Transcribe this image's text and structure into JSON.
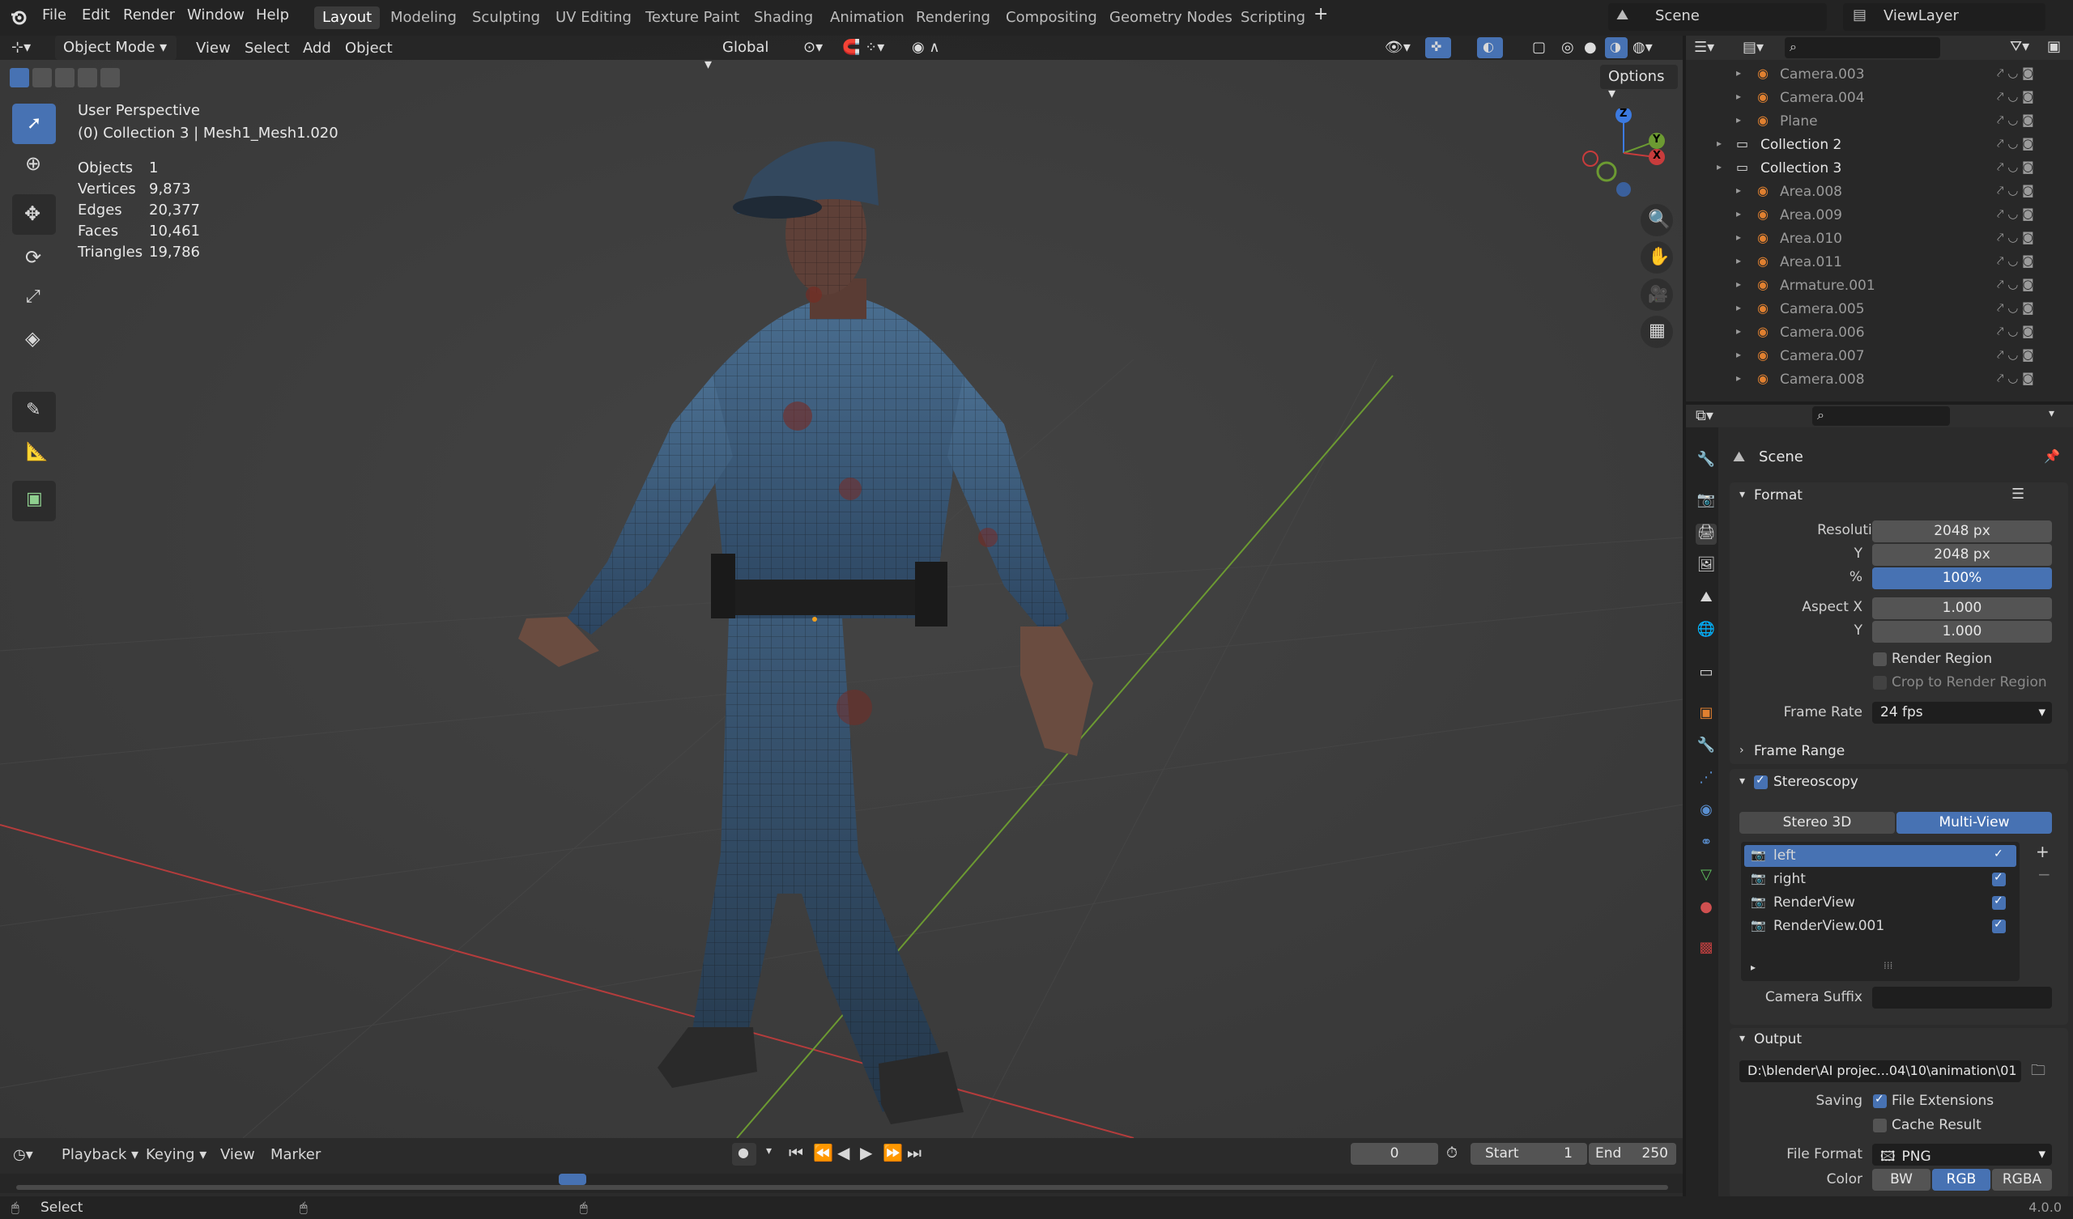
{
  "menu": [
    "File",
    "Edit",
    "Render",
    "Window",
    "Help"
  ],
  "workspaces": [
    "Layout",
    "Modeling",
    "Sculpting",
    "UV Editing",
    "Texture Paint",
    "Shading",
    "Animation",
    "Rendering",
    "Compositing",
    "Geometry Nodes",
    "Scripting"
  ],
  "active_workspace": "Layout",
  "scene_name": "Scene",
  "view_layer": "ViewLayer",
  "viewport_header": {
    "mode": "Object Mode",
    "view": "View",
    "select": "Select",
    "add": "Add",
    "object": "Object",
    "orientation": "Global",
    "options": "Options"
  },
  "overlay": {
    "perspective": "User Perspective",
    "collection_info": "(0) Collection 3 | Mesh1_Mesh1.020",
    "stats": [
      {
        "label": "Objects",
        "value": "1"
      },
      {
        "label": "Vertices",
        "value": "9,873"
      },
      {
        "label": "Edges",
        "value": "20,377"
      },
      {
        "label": "Faces",
        "value": "10,461"
      },
      {
        "label": "Triangles",
        "value": "19,786"
      }
    ]
  },
  "gizmo": {
    "x": "X",
    "y": "Y",
    "z": "Z"
  },
  "outliner": [
    {
      "name": "Camera.003",
      "indent": 2
    },
    {
      "name": "Camera.004",
      "indent": 2
    },
    {
      "name": "Plane",
      "indent": 2
    },
    {
      "name": "Collection 2",
      "indent": 1
    },
    {
      "name": "Collection 3",
      "indent": 1
    },
    {
      "name": "Area.008",
      "indent": 2
    },
    {
      "name": "Area.009",
      "indent": 2
    },
    {
      "name": "Area.010",
      "indent": 2
    },
    {
      "name": "Area.011",
      "indent": 2
    },
    {
      "name": "Armature.001",
      "indent": 2
    },
    {
      "name": "Camera.005",
      "indent": 2
    },
    {
      "name": "Camera.006",
      "indent": 2
    },
    {
      "name": "Camera.007",
      "indent": 2
    },
    {
      "name": "Camera.008",
      "indent": 2
    }
  ],
  "properties": {
    "context": "Scene",
    "format": {
      "title": "Format",
      "resolution_x_label": "Resolution X",
      "resolution_x": "2048 px",
      "y_label": "Y",
      "resolution_y": "2048 px",
      "pct_label": "%",
      "percent": "100%",
      "aspect_x_label": "Aspect X",
      "aspect_x": "1.000",
      "aspect_y_label": "Y",
      "aspect_y": "1.000",
      "render_region": "Render Region",
      "crop": "Crop to Render Region",
      "frame_rate_label": "Frame Rate",
      "frame_rate": "24 fps"
    },
    "frame_range": "Frame Range",
    "stereoscopy": {
      "title": "Stereoscopy",
      "mode_a": "Stereo 3D",
      "mode_b": "Multi-View",
      "views": [
        "left",
        "right",
        "RenderView",
        "RenderView.001"
      ],
      "camera_suffix_label": "Camera Suffix"
    },
    "output": {
      "title": "Output",
      "path": "D:\\blender\\AI projec...04\\10\\animation\\01",
      "saving_label": "Saving",
      "file_extensions": "File Extensions",
      "cache_result": "Cache Result",
      "file_format_label": "File Format",
      "file_format": "PNG",
      "color_label": "Color",
      "color_modes": [
        "BW",
        "RGB",
        "RGBA"
      ]
    }
  },
  "timeline": {
    "playback": "Playback",
    "keying": "Keying",
    "view": "View",
    "marker": "Marker",
    "current_frame": "0",
    "start_label": "Start",
    "start": "1",
    "end_label": "End",
    "end": "250"
  },
  "status": {
    "select": "Select",
    "version": "4.0.0"
  },
  "colors": {
    "accent": "#4772b3",
    "x_axis": "#c83c3c",
    "y_axis": "#6c9a32",
    "z_axis": "#3c7ae0"
  }
}
